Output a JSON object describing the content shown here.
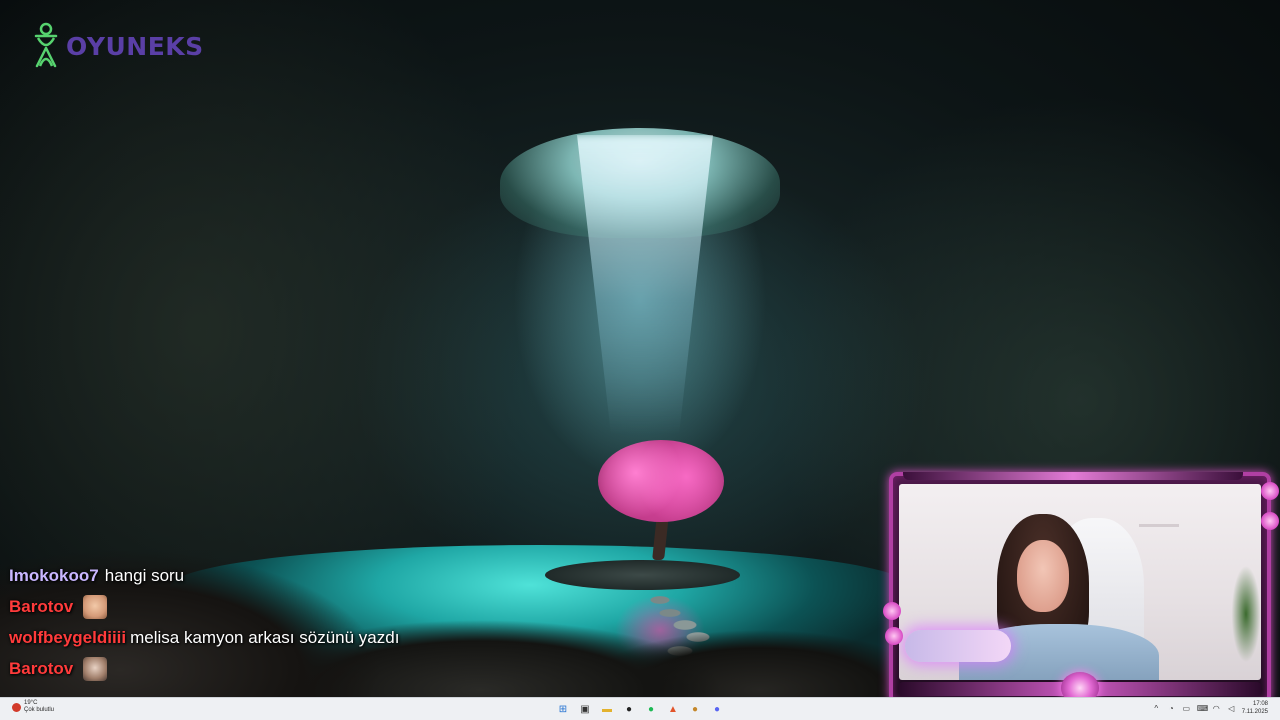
{
  "brand": {
    "name": "OYUNEKS",
    "color": "#5a3fa6",
    "mark_color": "#57d36f"
  },
  "chat": {
    "messages": [
      {
        "user": "Imokokoo7",
        "user_color": "#c9b6ff",
        "text": "hangi soru",
        "emote": null
      },
      {
        "user": "Barotov",
        "user_color": "#ff3b3b",
        "text": "",
        "emote": "laughing-face-emote"
      },
      {
        "user": "wolfbeygeldiiii",
        "user_color": "#ff3b3b",
        "text": "melisa kamyon arkası sözünü yazdı",
        "emote": null
      },
      {
        "user": "Barotov",
        "user_color": "#ff3b3b",
        "text": "",
        "emote": "face-emote"
      }
    ]
  },
  "taskbar": {
    "weather": {
      "temp": "19°C",
      "condition": "Çok bulutlu"
    },
    "pinned_apps": [
      {
        "name": "start",
        "glyph": "⊞",
        "color": "#1f6fd1"
      },
      {
        "name": "task-view",
        "glyph": "▣",
        "color": "#333333"
      },
      {
        "name": "file-explorer",
        "glyph": "▬",
        "color": "#e3b22e"
      },
      {
        "name": "obs",
        "glyph": "●",
        "color": "#222222"
      },
      {
        "name": "spotify",
        "glyph": "●",
        "color": "#1db954"
      },
      {
        "name": "brave",
        "glyph": "▲",
        "color": "#e2542a"
      },
      {
        "name": "chrome-variant",
        "glyph": "●",
        "color": "#c4872a"
      },
      {
        "name": "discord",
        "glyph": "●",
        "color": "#5865f2"
      }
    ],
    "clock": {
      "time": "17:08",
      "date": "7.11.2025"
    }
  },
  "colors": {
    "accent_frame": "#b03fa3",
    "taskbar_bg": "#eef0f3"
  }
}
